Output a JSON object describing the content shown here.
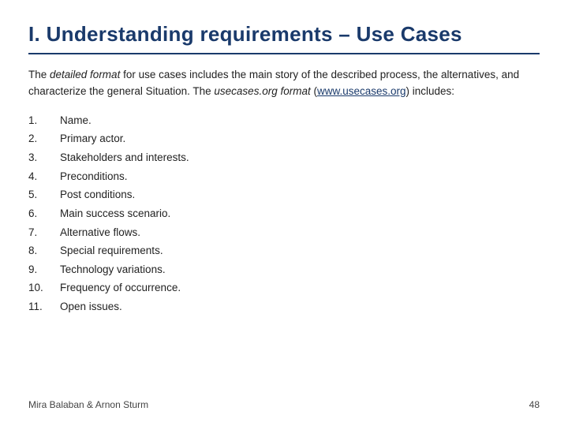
{
  "title": "I. Understanding requirements – Use Cases",
  "intro": {
    "part1": "The ",
    "italic1": "detailed format",
    "part2": " for use cases includes the main story of the described process, the alternatives, and characterize the general Situation. The ",
    "italic2": "usecases.org format",
    "part3": " (",
    "link_text": "www.usecases.org",
    "link_href": "www.usecases.org",
    "part4": ") includes:"
  },
  "list": [
    {
      "num": "1.",
      "text": "Name."
    },
    {
      "num": "2.",
      "text": "Primary actor."
    },
    {
      "num": "3.",
      "text": "Stakeholders and interests."
    },
    {
      "num": "4.",
      "text": "Preconditions."
    },
    {
      "num": "5.",
      "text": "Post conditions."
    },
    {
      "num": "6.",
      "text": "Main success scenario."
    },
    {
      "num": "7.",
      "text": "Alternative flows."
    },
    {
      "num": "8.",
      "text": "Special requirements."
    },
    {
      "num": "9.",
      "text": "Technology variations."
    },
    {
      "num": "10.",
      "text": "Frequency of occurrence."
    },
    {
      "num": "11.",
      "text": "Open issues."
    }
  ],
  "footer": {
    "authors": "Mira Balaban  &  Arnon Sturm",
    "page": "48"
  }
}
